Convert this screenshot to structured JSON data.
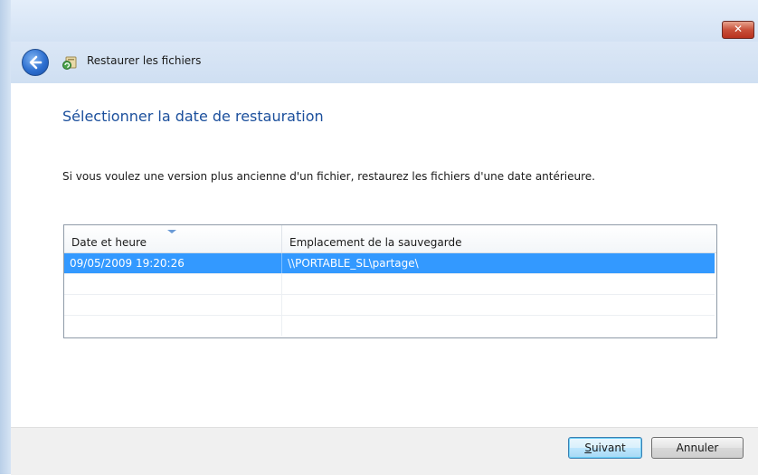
{
  "window": {
    "close_symbol": "✕",
    "title": "Restaurer les fichiers"
  },
  "icons": {
    "back": "back-arrow-icon",
    "app": "restore-files-icon",
    "close": "close-icon"
  },
  "main": {
    "heading": "Sélectionner la date de restauration",
    "description": "Si vous voulez une version plus ancienne d'un fichier, restaurez les fichiers d'une date antérieure."
  },
  "table": {
    "columns": [
      "Date et heure",
      "Emplacement de la sauvegarde"
    ],
    "rows": [
      {
        "date": "09/05/2009 19:20:26",
        "location": "\\\\PORTABLE_SL\\partage\\",
        "selected": true
      }
    ]
  },
  "buttons": {
    "next_first": "S",
    "next_rest": "uivant",
    "cancel": "Annuler"
  },
  "colors": {
    "selection": "#3399ff",
    "heading": "#1b4f9c",
    "close": "#c9503a"
  }
}
